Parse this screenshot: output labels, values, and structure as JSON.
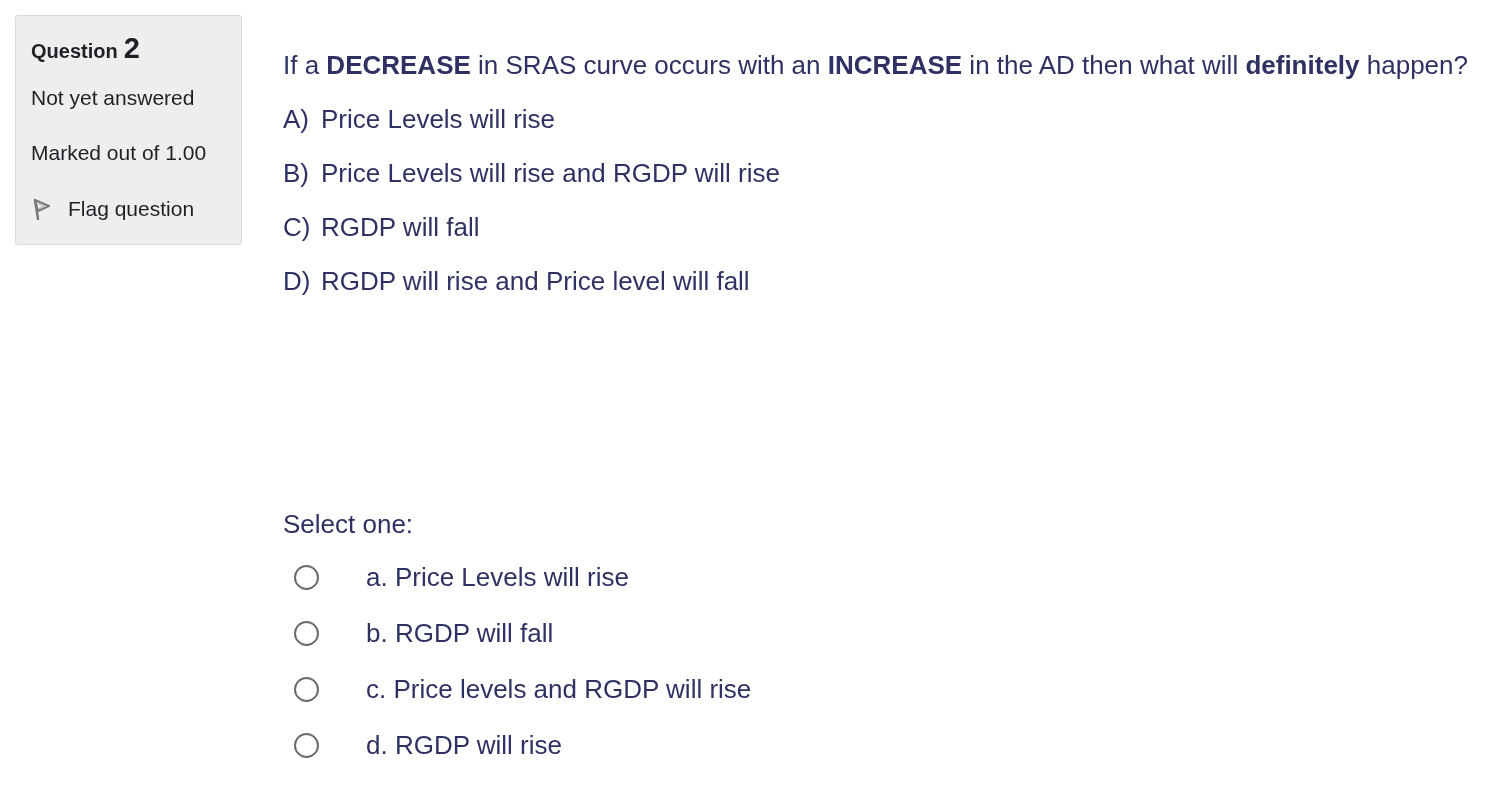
{
  "question_info": {
    "label": "Question",
    "number": "2",
    "state": "Not yet answered",
    "grade": "Marked out of 1.00",
    "flag": {
      "label": "Flag question",
      "flagged": false
    }
  },
  "question": {
    "text": "If a **DECREASE** in SRAS curve occurs with an **INCREASE** in the AD then what will **definitely** happen?",
    "listed_choices": [
      {
        "letter": "A)",
        "text": "Price Levels will rise"
      },
      {
        "letter": "B)",
        "text": "Price Levels will rise and RGDP will rise"
      },
      {
        "letter": "C)",
        "text": "RGDP will fall"
      },
      {
        "letter": "D)",
        "text": "RGDP will rise and Price level will fall"
      }
    ]
  },
  "answer": {
    "prompt": "Select one:",
    "options": [
      {
        "label": "a. Price Levels will rise",
        "selected": false
      },
      {
        "label": "b. RGDP will fall",
        "selected": false
      },
      {
        "label": "c. Price levels and RGDP will rise",
        "selected": false
      },
      {
        "label": "d. RGDP will rise",
        "selected": false
      }
    ]
  }
}
